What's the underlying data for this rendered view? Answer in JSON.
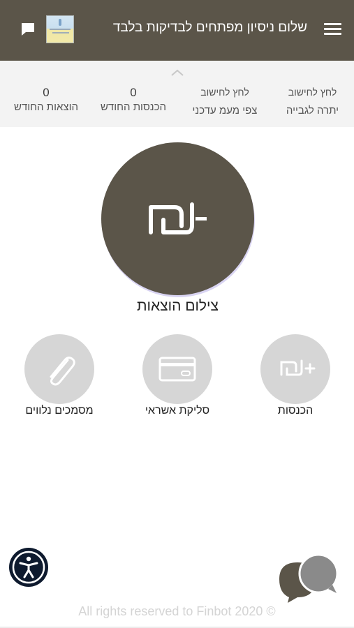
{
  "header": {
    "title": "שלום ניסיון מפתחים לבדיקות בלבד",
    "menu_icon": "hamburger-menu-icon",
    "chat_icon": "chat-icon",
    "logo": "organization-logo",
    "background": "#5b5549"
  },
  "stats": {
    "collapse_icon": "chevron-up-icon",
    "items": [
      {
        "top": "לחץ לחישוב",
        "label": "יתרה לגבייה"
      },
      {
        "top": "לחץ לחישוב",
        "label": "צפי מעמ עדכני"
      },
      {
        "top": "0",
        "label": "הכנסות החודש"
      },
      {
        "top": "0",
        "label": "הוצאות החודש"
      }
    ]
  },
  "main_action": {
    "label": "צילום הוצאות",
    "icon": "shekel-minus-icon",
    "color": "#5b5549"
  },
  "actions": [
    {
      "label": "הכנסות",
      "icon": "shekel-plus-icon"
    },
    {
      "label": "סליקת אשראי",
      "icon": "credit-card-icon"
    },
    {
      "label": "מסמכים נלווים",
      "icon": "paperclip-icon"
    }
  ],
  "accessibility_icon": "accessibility-icon",
  "chat_widget_icon": "chat-bubbles-icon",
  "footer": {
    "text": "All rights reserved to Finbot 2020 ©"
  }
}
